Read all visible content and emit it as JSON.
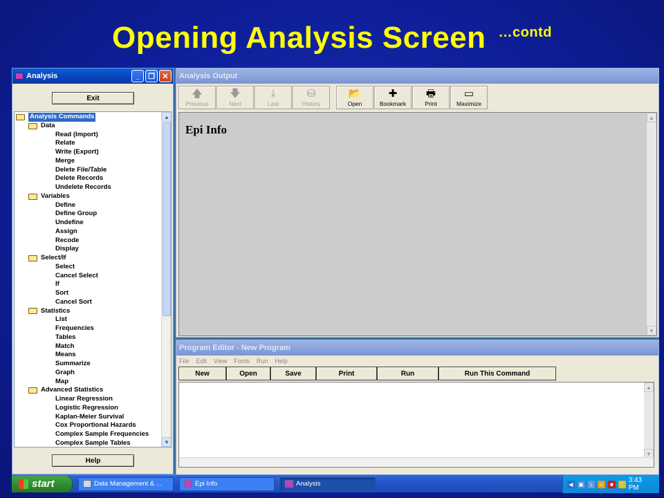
{
  "slide": {
    "title": "Opening Analysis Screen",
    "subtitle": "…contd"
  },
  "analysis_window": {
    "title": "Analysis",
    "exit_label": "Exit",
    "help_label": "Help",
    "tree": [
      {
        "label": "Analysis Commands",
        "level": 0,
        "folder": true,
        "selected": true
      },
      {
        "label": "Data",
        "level": 1,
        "folder": true
      },
      {
        "label": "Read (Import)",
        "level": 2
      },
      {
        "label": "Relate",
        "level": 2
      },
      {
        "label": "Write (Export)",
        "level": 2
      },
      {
        "label": "Merge",
        "level": 2
      },
      {
        "label": "Delete File/Table",
        "level": 2
      },
      {
        "label": "Delete Records",
        "level": 2
      },
      {
        "label": "Undelete Records",
        "level": 2
      },
      {
        "label": "Variables",
        "level": 1,
        "folder": true
      },
      {
        "label": "Define",
        "level": 2
      },
      {
        "label": "Define Group",
        "level": 2
      },
      {
        "label": "Undefine",
        "level": 2
      },
      {
        "label": "Assign",
        "level": 2
      },
      {
        "label": "Recode",
        "level": 2
      },
      {
        "label": "Display",
        "level": 2
      },
      {
        "label": "Select/If",
        "level": 1,
        "folder": true
      },
      {
        "label": "Select",
        "level": 2
      },
      {
        "label": "Cancel Select",
        "level": 2
      },
      {
        "label": "If",
        "level": 2
      },
      {
        "label": "Sort",
        "level": 2
      },
      {
        "label": "Cancel Sort",
        "level": 2
      },
      {
        "label": "Statistics",
        "level": 1,
        "folder": true
      },
      {
        "label": "List",
        "level": 2
      },
      {
        "label": "Frequencies",
        "level": 2
      },
      {
        "label": "Tables",
        "level": 2
      },
      {
        "label": "Match",
        "level": 2
      },
      {
        "label": "Means",
        "level": 2
      },
      {
        "label": "Summarize",
        "level": 2
      },
      {
        "label": "Graph",
        "level": 2
      },
      {
        "label": "Map",
        "level": 2
      },
      {
        "label": "Advanced Statistics",
        "level": 1,
        "folder": true
      },
      {
        "label": "Linear Regression",
        "level": 2
      },
      {
        "label": "Logistic Regression",
        "level": 2
      },
      {
        "label": "Kaplan-Meier Survival",
        "level": 2
      },
      {
        "label": "Cox Proportional Hazards",
        "level": 2
      },
      {
        "label": "Complex Sample Frequencies",
        "level": 2
      },
      {
        "label": "Complex Sample Tables",
        "level": 2
      }
    ]
  },
  "output_window": {
    "title": "Analysis Output",
    "toolbar": [
      {
        "label": "Previous",
        "icon": "up-arrow-icon",
        "glyph": "🡅",
        "disabled": true
      },
      {
        "label": "Next",
        "icon": "down-arrow-icon",
        "glyph": "🡇",
        "disabled": true
      },
      {
        "label": "Last",
        "icon": "last-arrow-icon",
        "glyph": "⤓",
        "disabled": true
      },
      {
        "label": "History",
        "icon": "history-icon",
        "glyph": "⛁",
        "disabled": true
      },
      {
        "label": "Open",
        "icon": "open-folder-icon",
        "glyph": "📂",
        "disabled": false
      },
      {
        "label": "Bookmark",
        "icon": "bookmark-icon",
        "glyph": "✚",
        "disabled": false
      },
      {
        "label": "Print",
        "icon": "printer-icon",
        "glyph": "🖶",
        "disabled": false
      },
      {
        "label": "Maximize",
        "icon": "maximize-icon",
        "glyph": "▭",
        "disabled": false
      }
    ],
    "content_text": "Epi Info"
  },
  "editor_window": {
    "title": "Program Editor - New Program",
    "menu": [
      "File",
      "Edit",
      "View",
      "Fonts",
      "Run",
      "Help"
    ],
    "buttons": [
      "New",
      "Open",
      "Save",
      "Print",
      "Run",
      "Run This Command"
    ]
  },
  "taskbar": {
    "start_label": "start",
    "tasks": [
      {
        "label": "Data Management & ...",
        "active": false
      },
      {
        "label": "Epi Info",
        "active": false
      },
      {
        "label": "Analysis",
        "active": true
      }
    ],
    "clock": "3:43 PM"
  }
}
